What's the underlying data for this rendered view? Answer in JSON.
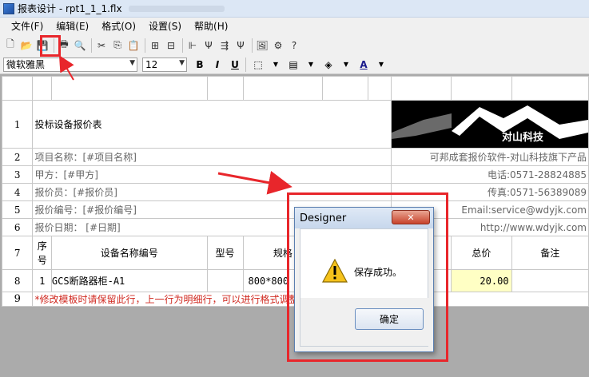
{
  "window": {
    "title": "报表设计 - rpt1_1_1.flx"
  },
  "menu": [
    {
      "label": "文件(F)"
    },
    {
      "label": "编辑(E)"
    },
    {
      "label": "格式(O)"
    },
    {
      "label": "设置(S)"
    },
    {
      "label": "帮助(H)"
    }
  ],
  "toolbar": {
    "icons": [
      "new-icon",
      "open-icon",
      "save-icon",
      "print-icon",
      "print-preview-icon",
      "cut-icon",
      "copy-icon",
      "paste-icon",
      "insert-row-icon",
      "delete-row-icon",
      "insert-col-icon",
      "delete-col-icon",
      "merge-icon",
      "split-icon",
      "image-icon",
      "properties-icon",
      "help-icon"
    ],
    "icon_glyphs": [
      "🗋",
      "📂",
      "💾",
      "🖶",
      "🔍",
      "✂",
      "⎘",
      "📋",
      "⊞",
      "⊟",
      "⊩",
      "Ψ",
      "⇶",
      "Ψ",
      "🖼",
      "⚙",
      "?"
    ]
  },
  "format": {
    "font_name": "微软雅黑",
    "font_size": "12",
    "bold": "B",
    "italic": "I",
    "underline": "U",
    "font_color_glyph": "A"
  },
  "sheet": {
    "row_numbers": [
      "1",
      "2",
      "3",
      "4",
      "5",
      "6",
      "7",
      "8",
      "9"
    ],
    "title": "投标设备报价表",
    "logo_text": "对山科技",
    "fields": [
      "项目名称：[#项目名称]",
      "甲方：[#甲方]",
      "报价员：[#报价员]",
      "报价编号：[#报价编号]",
      "报价日期：  [#日期]"
    ],
    "contacts": [
      "可邦成套报价软件-对山科技旗下产品",
      "电话:0571-28824885",
      "传真:0571-56389089",
      "Email:service@wdyjk.com",
      "http://www.wdyjk.com"
    ],
    "headers": {
      "seq": "序号",
      "name": "设备名称编号",
      "model": "型号",
      "spec": "规格",
      "total": "总价",
      "note": "备注"
    },
    "row8": {
      "seq": "1",
      "name": "GCS断路器柜-A1",
      "spec": "800*800",
      "total": "20.00"
    },
    "row9_note": "*修改模板时请保留此行，上一行为明细行，可以进行格式调整"
  },
  "dialog": {
    "title": "Designer",
    "close": "✕",
    "message": "保存成功。",
    "ok": "确定"
  }
}
